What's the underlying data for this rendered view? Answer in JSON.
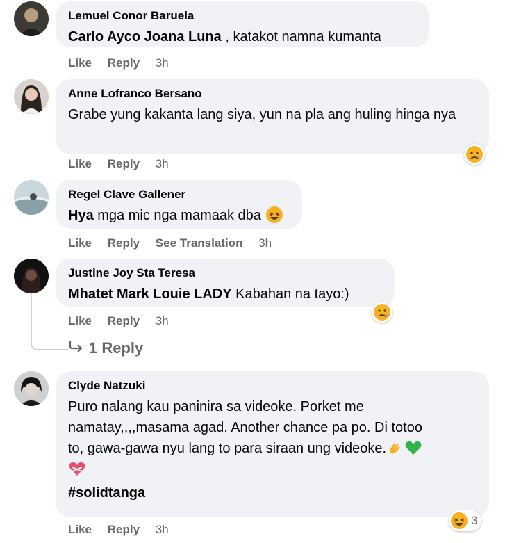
{
  "comments": [
    {
      "author": "Lemuel Conor Baruela",
      "tag": "Carlo Ayco Joana Luna",
      "text": " , katakot namna kumanta",
      "actions": {
        "like": "Like",
        "reply": "Reply",
        "time": "3h"
      }
    },
    {
      "author": "Anne Lofranco Bersano",
      "text": "Grabe yung kakanta lang siya, yun na pla ang huling hinga nya",
      "reaction": "sad-emoji",
      "actions": {
        "like": "Like",
        "reply": "Reply",
        "time": "3h"
      }
    },
    {
      "author": "Regel Clave Gallener",
      "tag": "Hya",
      "text": " mga mic nga mamaak dba",
      "inline_emoji": "laughing-emoji",
      "actions": {
        "like": "Like",
        "reply": "Reply",
        "translation": "See Translation",
        "time": "3h"
      }
    },
    {
      "author": "Justine Joy Sta Teresa",
      "tag": "Mhatet Mark Louie LADY",
      "text": " Kabahan na tayo:)",
      "reaction": "sad-emoji",
      "actions": {
        "like": "Like",
        "reply": "Reply",
        "time": "3h"
      },
      "replies_label": "1 Reply"
    },
    {
      "author": "Clyde Natzuki",
      "text_lines": [
        "Puro nalang kau paninira sa videoke. Porket me",
        "namatay,,,,masama agad. Another chance pa po. Di totoo",
        "to, gawa-gawa nyu lang to para siraan ung videoke."
      ],
      "hashtag": "#solidtanga",
      "reaction": "laughing-emoji",
      "reaction_count": "3",
      "actions": {
        "like": "Like",
        "reply": "Reply",
        "time": "3h"
      }
    }
  ]
}
